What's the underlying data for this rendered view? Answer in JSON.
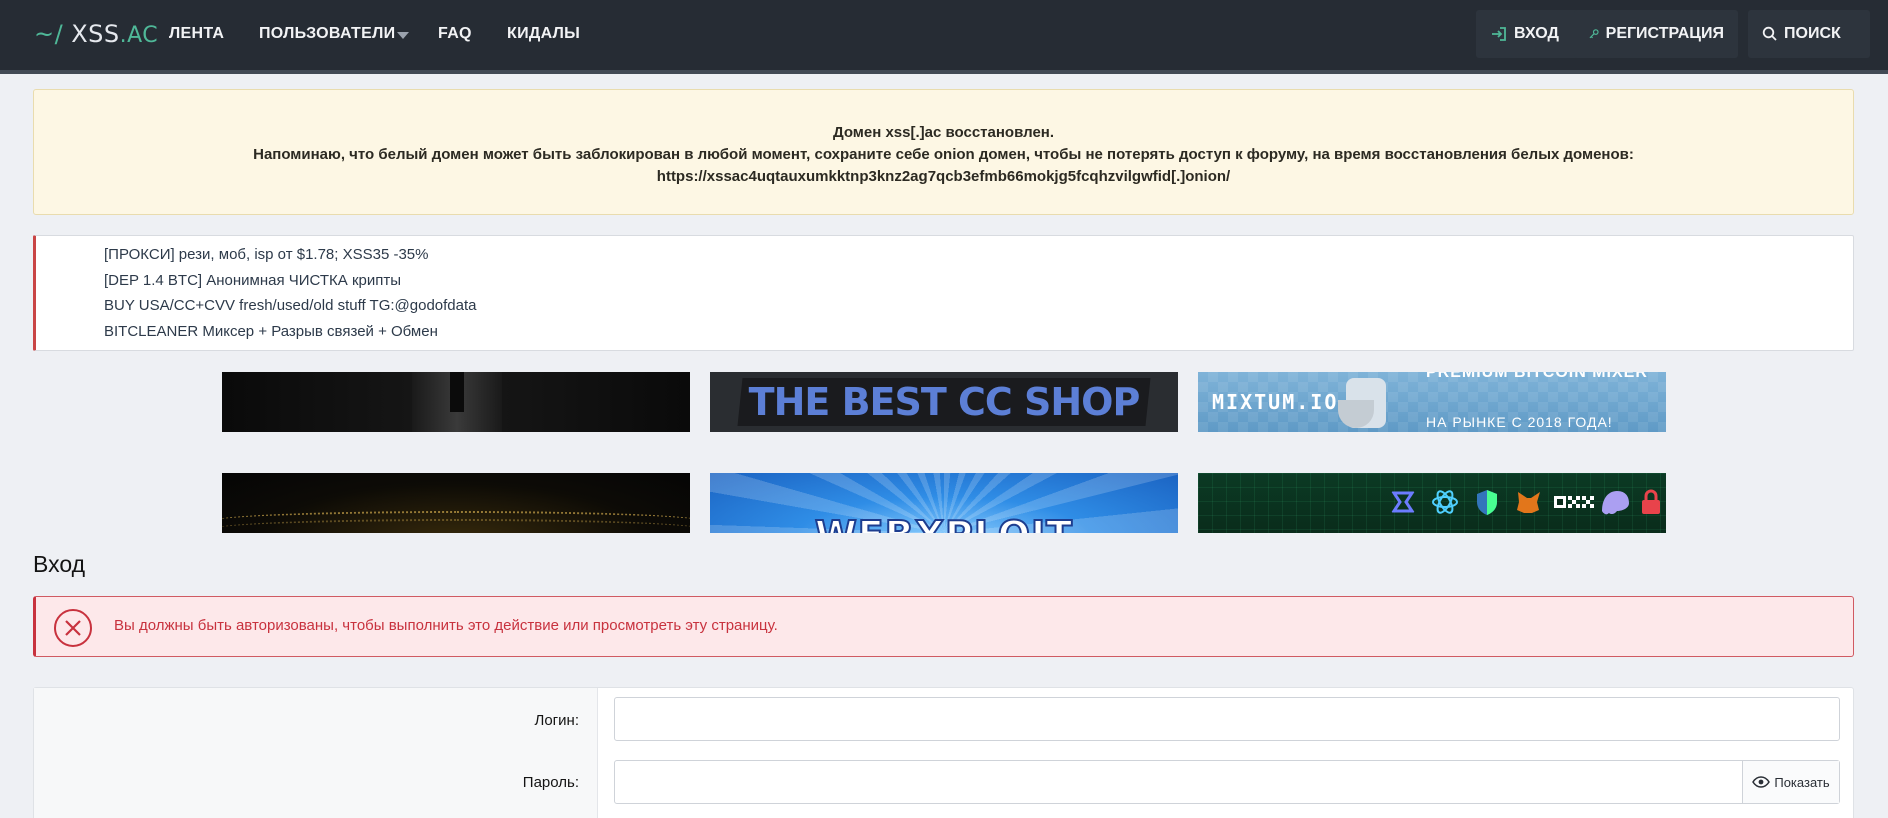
{
  "header": {
    "logo_tilde": "~/",
    "logo_main": "XSS",
    "logo_domain": ".AC",
    "nav": [
      "ЛЕНТА",
      "ПОЛЬЗОВАТЕЛИ",
      "FAQ",
      "КИДАЛЫ"
    ],
    "login_label": "ВХОД",
    "register_label": "РЕГИСТРАЦИЯ",
    "search_label": "ПОИСК"
  },
  "notice": {
    "line1": "Домен xss[.]ac восстановлен.",
    "line2": "Напоминаю, что белый домен может быть заблокирован в любой момент, сохраните себе onion домен, чтобы не потерять доступ к форуму, на время восстановления белых доменов:",
    "line3": "https://xssac4uqtauxumkktnp3knz2ag7qcb3efmb66mokjg5fcqhzvilgwfid[.]onion/"
  },
  "ads": [
    "[ПРОКСИ] рези, моб, isp от $1.78; XSS35 -35%",
    "[DEP 1.4 BTC] Анонимная ЧИСТКА крипты",
    "BUY USA/CC+CVV fresh/used/old stuff TG:@godofdata",
    "BITCLEANER Миксер + Разрыв связей + Обмен"
  ],
  "banners": {
    "b2_text": "THE BEST CC SHOP",
    "b3_brand": "MIXTUM.IO",
    "b3_top": "PREMIUM BITCOIN MIXER",
    "b3_since": "НА РЫНКЕ С 2018 ГОДА!",
    "b5_text": "WEBXPLOIT"
  },
  "page": {
    "title": "Вход"
  },
  "error": {
    "text": "Вы должны быть авторизованы, чтобы выполнить это действие или просмотреть эту страницу."
  },
  "form": {
    "login_label": "Логин:",
    "password_label": "Пароль:",
    "show_label": "Показать",
    "login_value": "",
    "password_value": ""
  },
  "colors": {
    "header_bg": "#262c34",
    "accent": "#4fb898",
    "error": "#c8323e",
    "notice_bg": "#fdf7e4"
  }
}
